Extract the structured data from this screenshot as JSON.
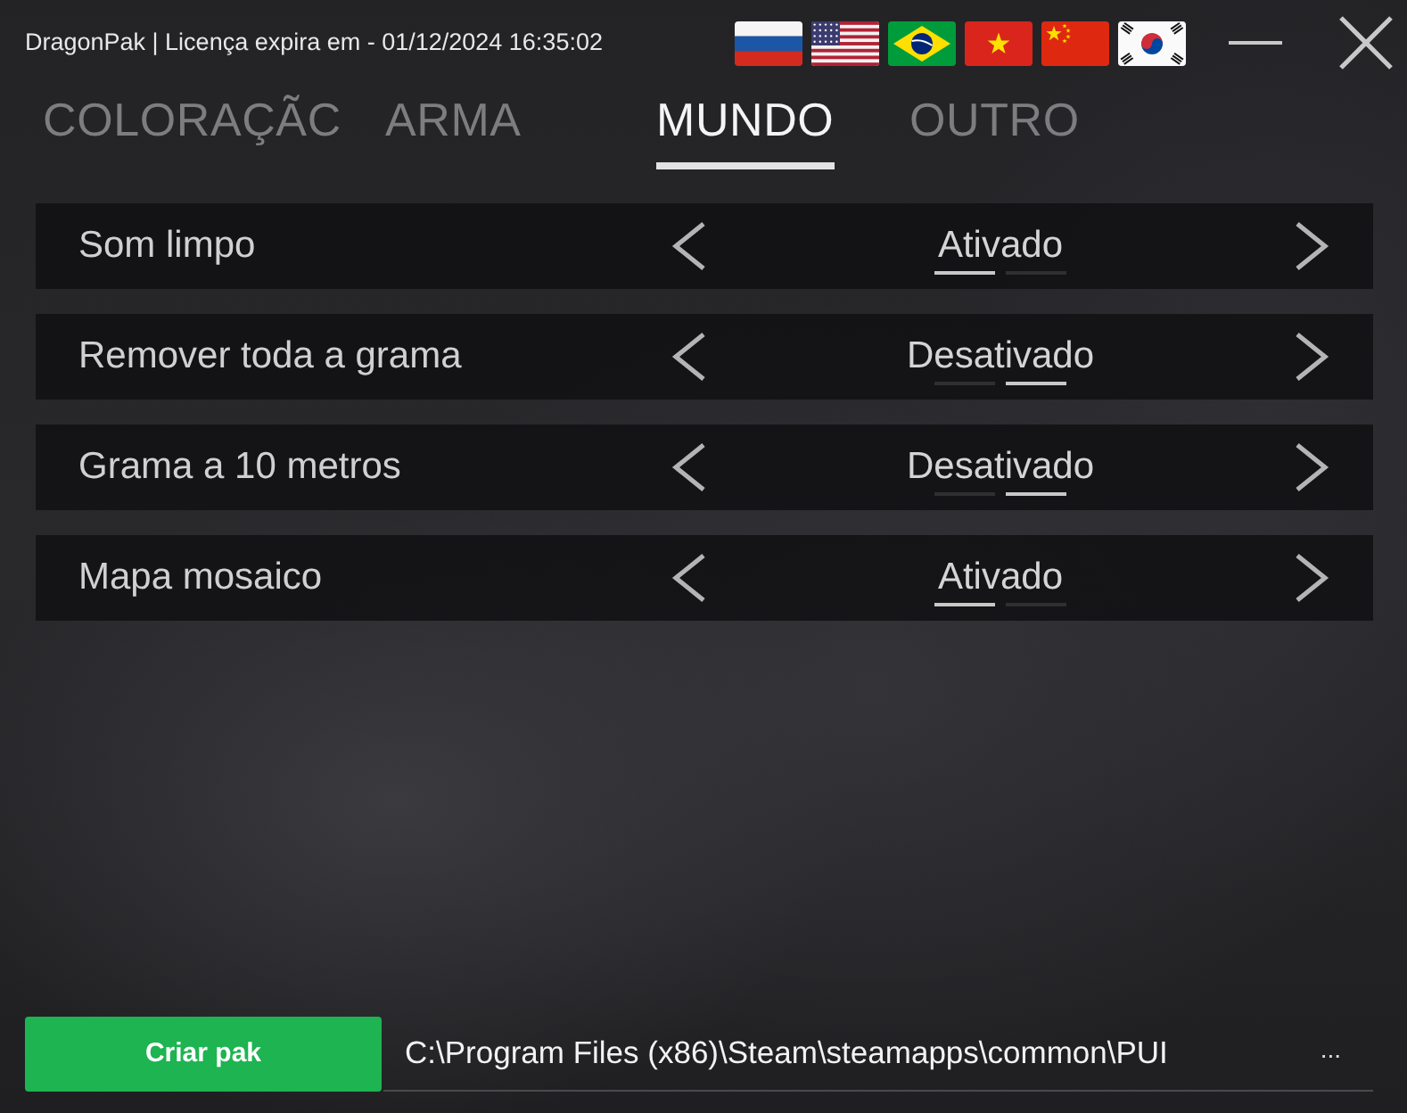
{
  "window": {
    "title": "DragonPak | Licença expira em - 01/12/2024 16:35:02"
  },
  "languages": [
    {
      "kind": "ru"
    },
    {
      "kind": "us"
    },
    {
      "kind": "br"
    },
    {
      "kind": "vn"
    },
    {
      "kind": "cn"
    },
    {
      "kind": "kr"
    }
  ],
  "tabs": [
    {
      "label": "COLORAÇÃC",
      "selected": false
    },
    {
      "label": "ARMA",
      "selected": false
    },
    {
      "label": "MUNDO",
      "selected": true
    },
    {
      "label": "OUTRO",
      "selected": false
    }
  ],
  "settings": [
    {
      "label": "Som limpo",
      "value": "Ativado",
      "segments": [
        {
          "selected": true
        },
        {
          "selected": false
        }
      ]
    },
    {
      "label": "Remover toda a grama",
      "value": "Desativado",
      "segments": [
        {
          "selected": false
        },
        {
          "selected": true
        }
      ]
    },
    {
      "label": "Grama a 10 metros",
      "value": "Desativado",
      "segments": [
        {
          "selected": false
        },
        {
          "selected": true
        }
      ]
    },
    {
      "label": "Mapa mosaico",
      "value": "Ativado",
      "segments": [
        {
          "selected": true
        },
        {
          "selected": false
        }
      ]
    }
  ],
  "footer": {
    "button": "Criar pak",
    "path": "C:\\Program Files (x86)\\Steam\\steamapps\\common\\PUI",
    "browse": "..."
  }
}
